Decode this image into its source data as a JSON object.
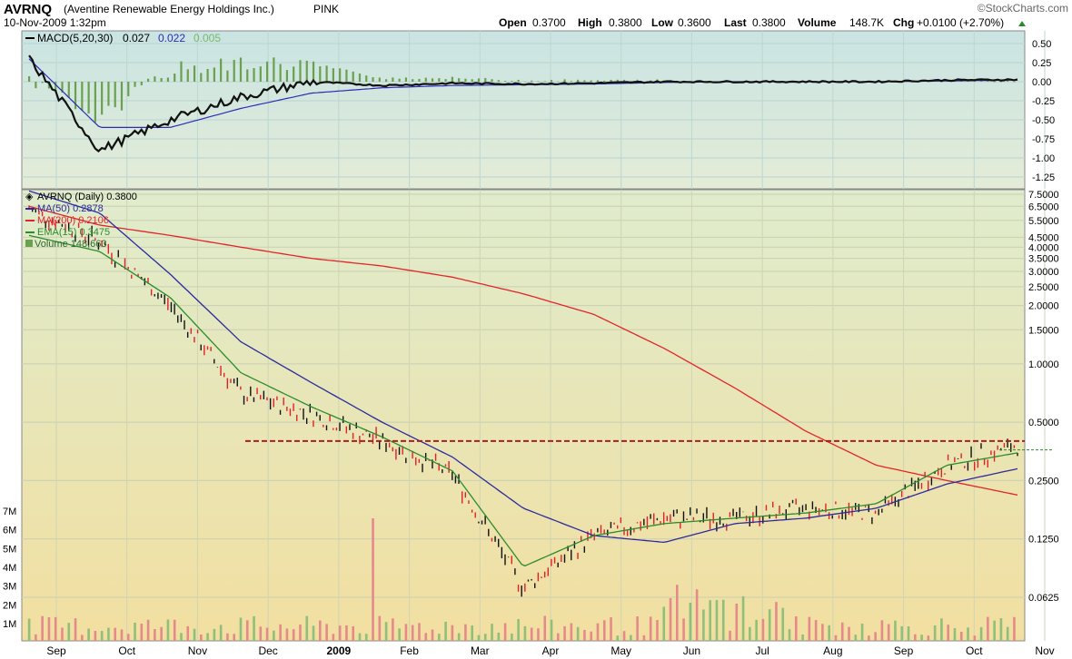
{
  "header": {
    "symbol": "AVRNQ",
    "company": "(Aventine Renewable Energy Holdings Inc.)",
    "exchange": "PINK",
    "datetime": "10-Nov-2009 1:32pm",
    "watermark": "©StockCharts.com",
    "quote": {
      "open_label": "Open",
      "open": "0.3700",
      "high_label": "High",
      "high": "0.3800",
      "low_label": "Low",
      "low": "0.3600",
      "last_label": "Last",
      "last": "0.3800",
      "volume_label": "Volume",
      "volume": "148.7K",
      "chg_label": "Chg",
      "chg": "+0.0100 (+2.70%)"
    }
  },
  "colors": {
    "macd_bg_top": "#c9e4e3",
    "macd_bg_bottom": "#e4ecd7",
    "price_bg_top": "#dfeccd",
    "price_bg_bottom": "#f2dfa0",
    "up": "#111111",
    "down": "#e0202a",
    "ma50": "#2b2b9e",
    "ma200": "#e3242b",
    "ema15": "#2c8c2c",
    "macd_line": "#111111",
    "signal_line": "#2b2bb8",
    "histogram": "#6aa04f",
    "vol_up": "#8fbf7a",
    "vol_down": "#e58a8a",
    "resistance": "#a81f1f"
  },
  "macd_panel": {
    "legend_label": "MACD(5,20,30)",
    "macd_value": "0.027",
    "signal_value": "0.022",
    "hist_value": "0.005",
    "y_ticks": [
      "0.50",
      "0.25",
      "0.00",
      "-0.25",
      "-0.50",
      "-0.75",
      "-1.00",
      "-1.25"
    ]
  },
  "price_panel": {
    "legend": {
      "symbol": "AVRNQ (Daily) 0.3800",
      "ma50": "MA(50) 0.2878",
      "ma200": "MA(200) 0.2106",
      "ema15": "EMA(15) 0.3475",
      "volume": "Volume 148,663"
    },
    "y_ticks": [
      "7.5000",
      "6.5000",
      "5.5000",
      "4.5000",
      "4.0000",
      "3.5000",
      "3.0000",
      "2.5000",
      "2.0000",
      "1.5000",
      "1.0000",
      "0.5000",
      "0.2500",
      "0.1250",
      "0.0625"
    ],
    "volume_ticks": [
      "7M",
      "6M",
      "5M",
      "4M",
      "3M",
      "2M",
      "1M"
    ]
  },
  "x_axis": {
    "labels": [
      "Sep",
      "Oct",
      "Nov",
      "Dec",
      "2009",
      "Feb",
      "Mar",
      "Apr",
      "May",
      "Jun",
      "Jul",
      "Aug",
      "Sep",
      "Oct",
      "Nov"
    ]
  },
  "chart_data": {
    "type": "line",
    "title": "AVRNQ (Daily) 0.3800",
    "scale": "log",
    "x": [
      "2008-09",
      "2008-10",
      "2008-11",
      "2008-12",
      "2009-01",
      "2009-02",
      "2009-03",
      "2009-04",
      "2009-05",
      "2009-06",
      "2009-07",
      "2009-08",
      "2009-09",
      "2009-10",
      "2009-11"
    ],
    "series": [
      {
        "name": "AVRNQ (Daily)",
        "values": [
          6.3,
          4.3,
          2.0,
          0.7,
          0.55,
          0.4,
          0.27,
          0.07,
          0.13,
          0.16,
          0.16,
          0.18,
          0.17,
          0.3,
          0.38
        ]
      },
      {
        "name": "MA(50)",
        "values": [
          7.8,
          6.0,
          2.9,
          1.3,
          0.8,
          0.5,
          0.33,
          0.18,
          0.13,
          0.12,
          0.15,
          0.16,
          0.18,
          0.24,
          0.2878
        ]
      },
      {
        "name": "MA(200)",
        "values": [
          6.5,
          5.2,
          4.6,
          4.0,
          3.5,
          3.2,
          2.8,
          2.3,
          1.8,
          1.2,
          0.75,
          0.45,
          0.3,
          0.25,
          0.2106
        ]
      },
      {
        "name": "EMA(15)",
        "values": [
          4.6,
          3.8,
          2.2,
          0.9,
          0.6,
          0.42,
          0.28,
          0.09,
          0.13,
          0.15,
          0.16,
          0.17,
          0.19,
          0.3,
          0.3475
        ]
      }
    ],
    "resistance_level": 0.4,
    "macd": {
      "name": "MACD(5,20,30)",
      "values": [
        0.3,
        -0.9,
        -0.5,
        -0.2,
        0.0,
        -0.05,
        -0.02,
        -0.03,
        -0.02,
        0.0,
        0.0,
        0.0,
        0.0,
        0.02,
        0.027
      ],
      "signal": [
        0.3,
        -0.6,
        -0.6,
        -0.35,
        -0.15,
        -0.08,
        -0.05,
        -0.04,
        -0.03,
        -0.01,
        0.0,
        0.0,
        0.0,
        0.01,
        0.022
      ]
    },
    "ylabel": "",
    "xlabel": ""
  }
}
